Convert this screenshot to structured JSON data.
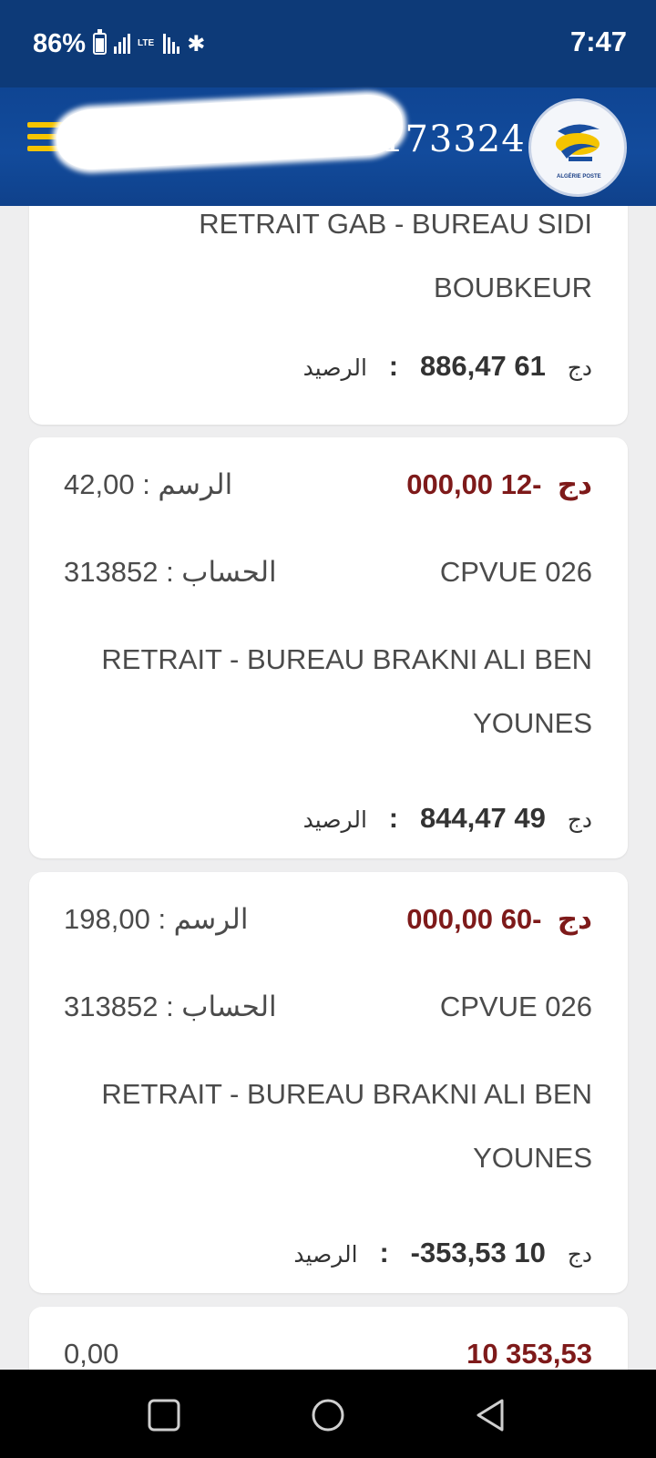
{
  "status_bar": {
    "battery": "86%",
    "network": "LTE",
    "time": "7:47"
  },
  "header": {
    "account_number": "173324",
    "logo_caption": "ALGÉRIE POSTE"
  },
  "transactions": [
    {
      "description_lines": [
        "RETRAIT GAB - BUREAU SIDI",
        "BOUBKEUR"
      ],
      "balance_label": "الرصيد",
      "balance": "61 886,47",
      "currency": "دج"
    },
    {
      "amount": "-12 000,00",
      "currency": "دج",
      "fee_label": "الرسم",
      "fee": "42,00",
      "account_label": "الحساب",
      "account": "313852",
      "branch": "CPVUE 026",
      "description_lines": [
        "RETRAIT - BUREAU BRAKNI ALI BEN",
        "YOUNES"
      ],
      "balance_label": "الرصيد",
      "balance": "49 844,47"
    },
    {
      "amount": "-60 000,00",
      "currency": "دج",
      "fee_label": "الرسم",
      "fee": "198,00",
      "account_label": "الحساب",
      "account": "313852",
      "branch": "CPVUE 026",
      "description_lines": [
        "RETRAIT - BUREAU BRAKNI ALI BEN",
        "YOUNES"
      ],
      "balance_label": "الرصيد",
      "balance": "10 353,53-"
    },
    {
      "fee": "0,00",
      "amount": "10 353,53"
    }
  ],
  "colors": {
    "header": "#0f4593",
    "accent_yellow": "#f5c400",
    "debit": "#7e1a1a"
  },
  "icons": [
    "menu-icon",
    "battery-icon",
    "signal-icon",
    "bluetooth-icon",
    "algerie-poste-logo",
    "nav-recents-icon",
    "nav-home-icon",
    "nav-back-icon"
  ]
}
